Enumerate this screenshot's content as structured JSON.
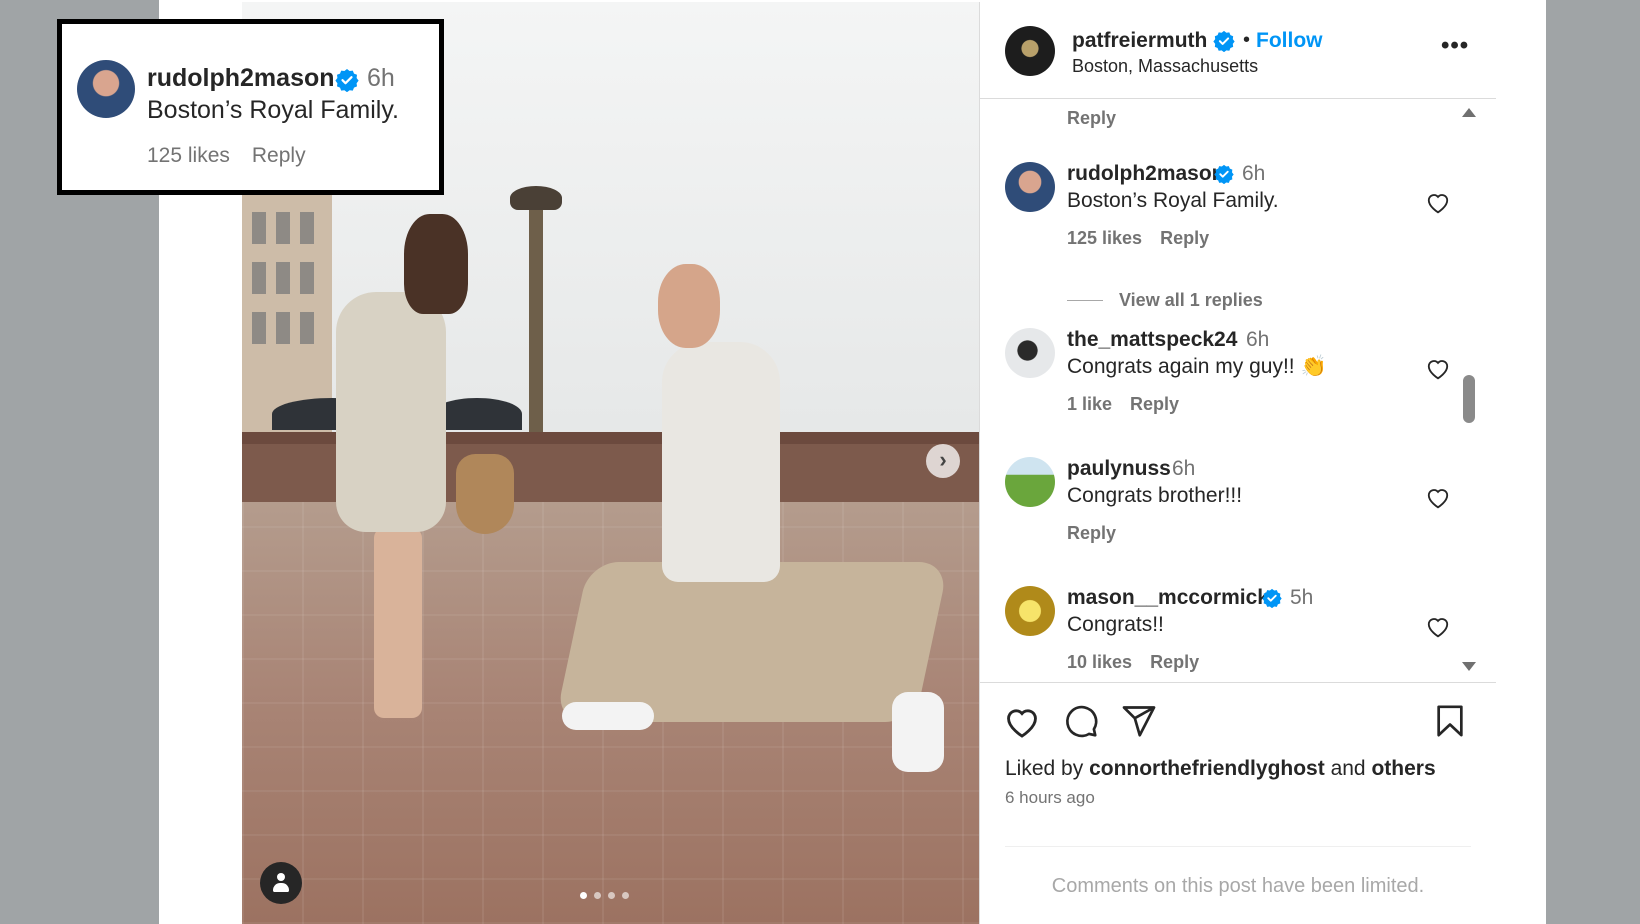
{
  "callout": {
    "username": "rudolph2mason",
    "time": "6h",
    "text": "Boston’s Royal Family.",
    "likes": "125 likes",
    "reply_label": "Reply"
  },
  "post": {
    "author": "patfreiermuth",
    "follow_label": "Follow",
    "separator": "•",
    "location": "Boston, Massachusetts",
    "more_label": "•••"
  },
  "comments": {
    "top_reply_label": "Reply",
    "items": [
      {
        "username": "rudolph2mason",
        "verified": true,
        "time": "6h",
        "text": "Boston’s Royal Family.",
        "likes": "125 likes",
        "reply": "Reply"
      },
      {
        "username": "the_mattspeck24",
        "verified": false,
        "time": "6h",
        "text": "Congrats again my guy!! 👏",
        "likes": "1 like",
        "reply": "Reply"
      },
      {
        "username": "paulynuss",
        "verified": false,
        "time": "6h",
        "text": "Congrats brother!!!",
        "likes": "",
        "reply": "Reply"
      },
      {
        "username": "mason__mccormick",
        "verified": true,
        "time": "5h",
        "text": "Congrats!!",
        "likes": "10 likes",
        "reply": "Reply"
      }
    ],
    "view_replies_label": "View all 1 replies"
  },
  "actions": {
    "liked_prefix": "Liked by",
    "liked_user": "connorthefriendlyghost",
    "liked_and": "and",
    "liked_others": "others",
    "time_ago": "6 hours ago",
    "limited_notice": "Comments on this post have been limited."
  },
  "carousel": {
    "slide_count": 4,
    "active_index": 0
  },
  "colors": {
    "accent": "#0095f6",
    "verified": "#0095f6",
    "muted": "#737373"
  },
  "icons": {
    "verified": "verified-badge-icon",
    "heart": "heart-icon",
    "comment": "comment-icon",
    "share": "share-icon",
    "save": "bookmark-icon",
    "next": "chevron-right-icon",
    "tag": "user-tag-icon"
  }
}
